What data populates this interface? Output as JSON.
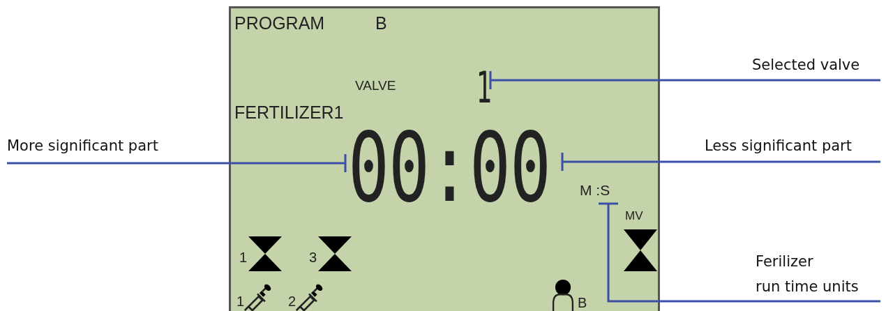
{
  "lcd": {
    "program_label": "PROGRAM",
    "program": "B",
    "valve_label": "VALVE",
    "valve": "1",
    "fertilizer": "FERTILIZER1",
    "time": "00:00",
    "units": "M :S",
    "mv": "MV",
    "valves": [
      {
        "number": "1"
      },
      {
        "number": "3"
      }
    ],
    "fertilizers": [
      {
        "number": "1"
      },
      {
        "number": "2"
      }
    ],
    "person_label": "B"
  },
  "callouts": [
    {
      "lines": [
        "Selected valve"
      ]
    },
    {
      "lines": [
        "More significant part"
      ]
    },
    {
      "lines": [
        "Less significant part"
      ]
    },
    {
      "lines": [
        "Ferilizer",
        "run time units"
      ]
    }
  ]
}
